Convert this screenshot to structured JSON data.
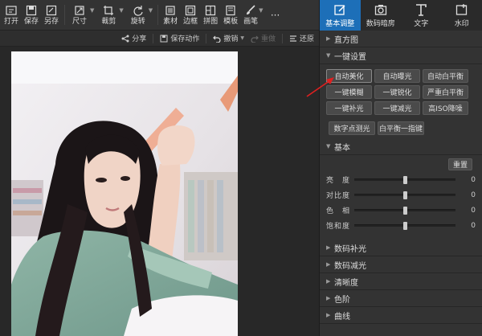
{
  "toolbar": {
    "open": "打开",
    "save": "保存",
    "save_as": "另存",
    "size": "尺寸",
    "crop": "裁剪",
    "rotate": "旋转",
    "material": "素材",
    "border": "边框",
    "collage": "拼图",
    "template": "模板",
    "brush": "画笔",
    "more": "···"
  },
  "subbar": {
    "share": "分享",
    "save_action": "保存动作",
    "undo": "撤销",
    "redo": "重做",
    "restore": "还原"
  },
  "right_tabs": [
    {
      "label": "基本调整"
    },
    {
      "label": "数码暗房"
    },
    {
      "label": "文字"
    },
    {
      "label": "水印"
    }
  ],
  "panel": {
    "histogram": "直方图",
    "one_click": "一键设置",
    "buttons": [
      "自动美化",
      "自动曝光",
      "自动白平衡",
      "一键模糊",
      "一键锐化",
      "严重白平衡",
      "一键补光",
      "一键减光",
      "高ISO降噪"
    ],
    "buttons2": [
      "数字点测光",
      "白平衡一指键"
    ],
    "basic": "基本",
    "reset": "重置",
    "sliders": [
      {
        "label": "亮　度",
        "value": "0",
        "level": 0.5
      },
      {
        "label": "对比度",
        "value": "0",
        "level": 0.5
      },
      {
        "label": "色　相",
        "value": "0",
        "level": 0.5
      },
      {
        "label": "饱和度",
        "value": "0",
        "level": 0.5
      }
    ],
    "collapsed_sections": [
      "数码补光",
      "数码减光",
      "清晰度",
      "色阶",
      "曲线"
    ]
  }
}
